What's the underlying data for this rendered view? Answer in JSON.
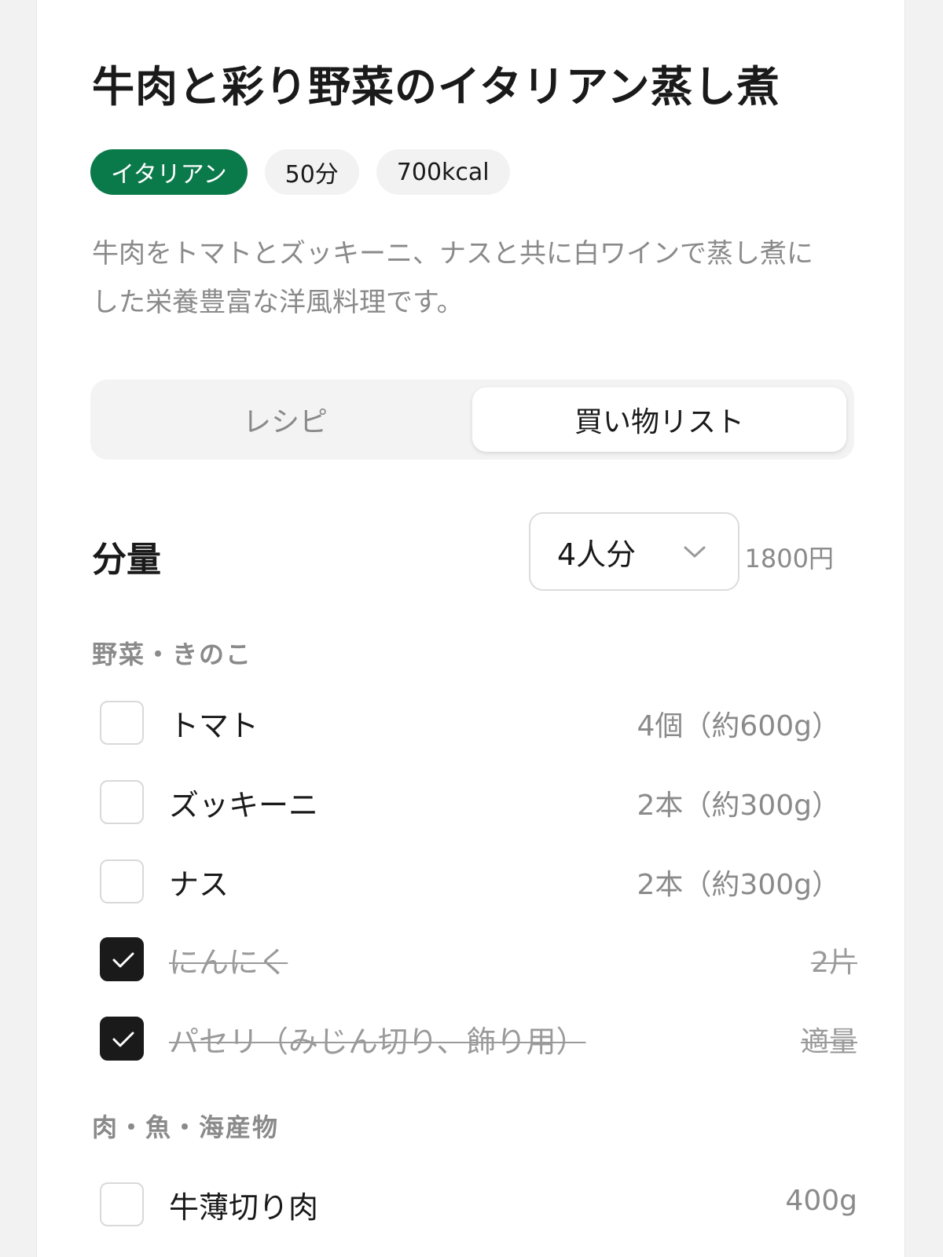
{
  "recipe": {
    "title": "牛肉と彩り野菜のイタリアン蒸し煮",
    "tags": [
      "イタリアン",
      "50分",
      "700kcal"
    ],
    "description": "牛肉をトマトとズッキーニ、ナスと共に白ワインで蒸し煮にした栄養豊富な洋風料理です。"
  },
  "tabs": {
    "recipe": "レシピ",
    "shopping": "買い物リスト",
    "active": "shopping"
  },
  "servings": {
    "label": "分量",
    "selected": "4人分",
    "price": "1800円"
  },
  "sections": [
    {
      "title": "野菜・きのこ",
      "items": [
        {
          "name": "トマト",
          "qty": "4個（約600g）",
          "checked": false
        },
        {
          "name": "ズッキーニ",
          "qty": "2本（約300g）",
          "checked": false
        },
        {
          "name": "ナス",
          "qty": "2本（約300g）",
          "checked": false
        },
        {
          "name": "にんにく",
          "qty": "2片",
          "checked": true
        },
        {
          "name": "パセリ（みじん切り、飾り用）",
          "qty": "適量",
          "checked": true
        }
      ]
    },
    {
      "title": "肉・魚・海産物",
      "items": [
        {
          "name": "牛薄切り肉",
          "qty": "400g",
          "checked": false
        }
      ]
    }
  ],
  "colors": {
    "accent": "#0b7a4b",
    "check": "#1a1a1a",
    "muted": "#8a8a8a"
  }
}
